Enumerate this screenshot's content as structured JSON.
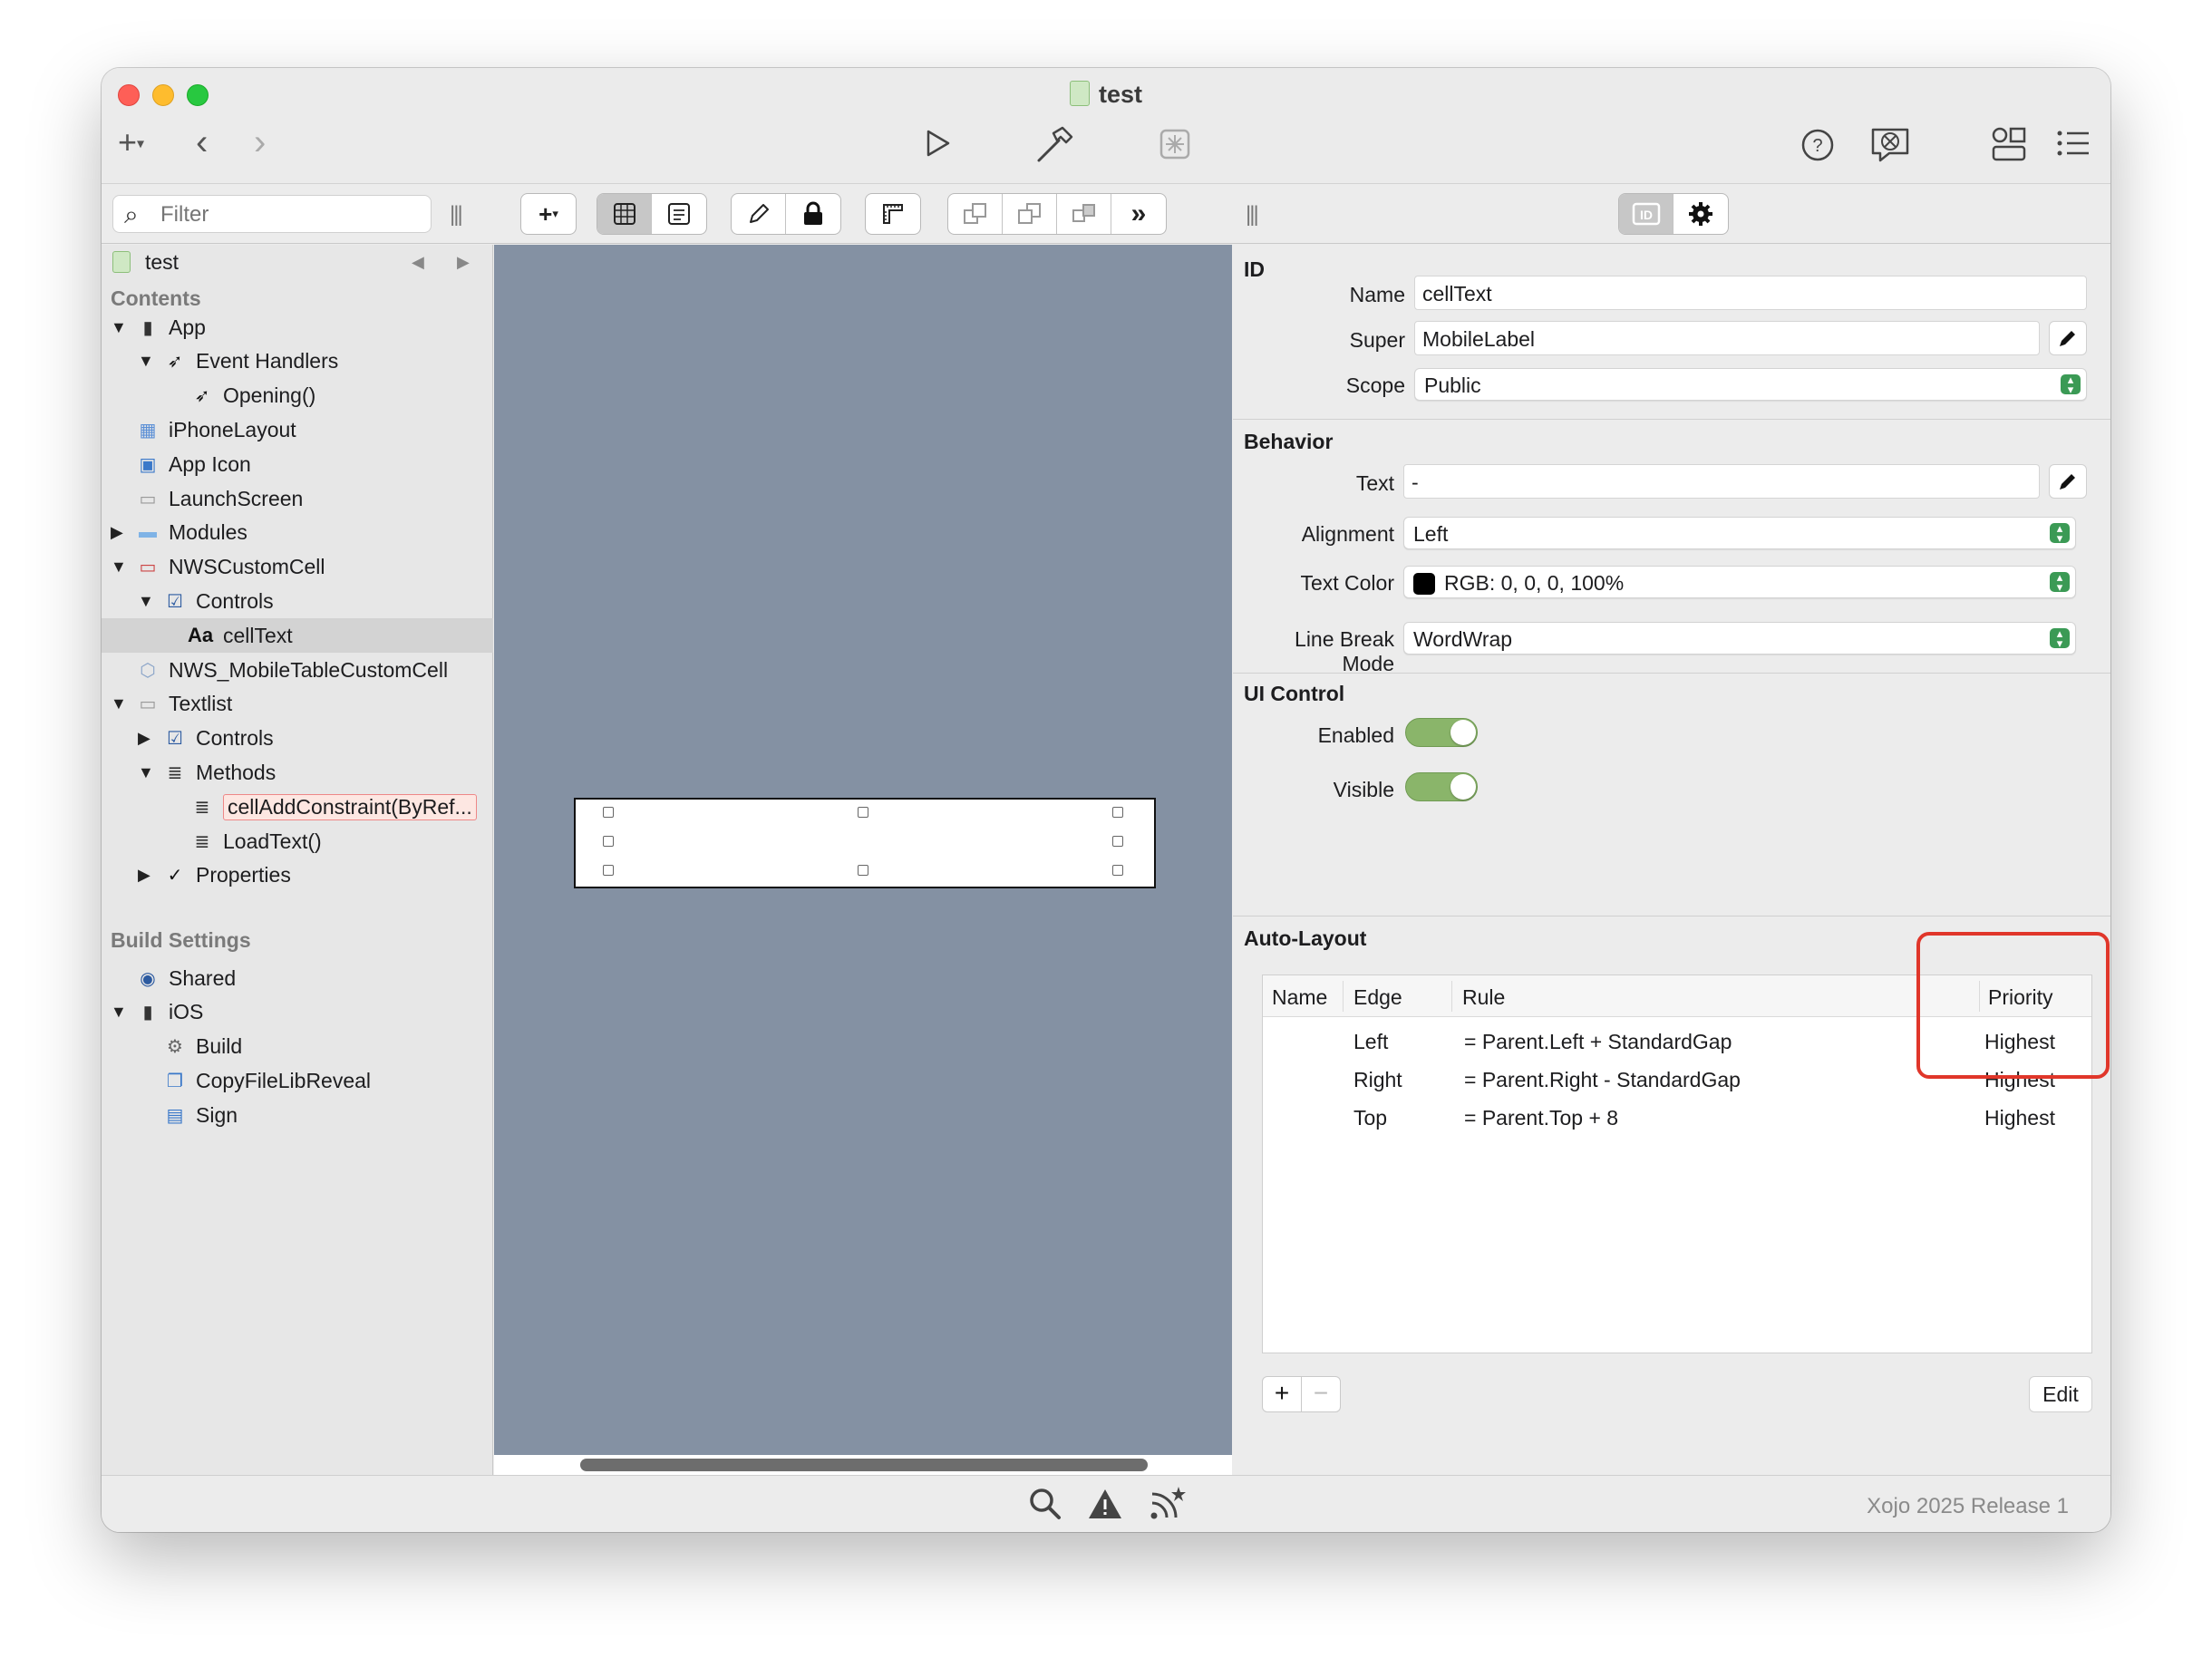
{
  "window": {
    "title": "test"
  },
  "toolbar": {
    "add_icon": "plus-icon",
    "back_icon": "chevron-left-icon",
    "forward_icon": "chevron-right-icon",
    "run_icon": "play-icon",
    "build_icon": "hammer-icon",
    "debug_icon": "bug-icon",
    "help_icon": "help-icon",
    "feedback_icon": "feedback-icon",
    "library_icon": "library-icon",
    "list_icon": "list-icon"
  },
  "navigator": {
    "filter_placeholder": "Filter",
    "project_name": "test",
    "contents_header": "Contents",
    "items": [
      {
        "label": "App",
        "depth": 0,
        "expanded": true
      },
      {
        "label": "Event Handlers",
        "depth": 1,
        "expanded": true
      },
      {
        "label": "Opening()",
        "depth": 2
      },
      {
        "label": "iPhoneLayout",
        "depth": 0
      },
      {
        "label": "App Icon",
        "depth": 0
      },
      {
        "label": "LaunchScreen",
        "depth": 0
      },
      {
        "label": "Modules",
        "depth": 0,
        "expanded": false
      },
      {
        "label": "NWSCustomCell",
        "depth": 0,
        "expanded": true
      },
      {
        "label": "Controls",
        "depth": 1,
        "expanded": true
      },
      {
        "label": "cellText",
        "depth": 2,
        "selected": true
      },
      {
        "label": "NWS_MobileTableCustomCell",
        "depth": 0
      },
      {
        "label": "Textlist",
        "depth": 0,
        "expanded": true
      },
      {
        "label": "Controls",
        "depth": 1,
        "expanded": false
      },
      {
        "label": "Methods",
        "depth": 1,
        "expanded": true
      },
      {
        "label": "cellAddConstraint(ByRef...",
        "depth": 2,
        "highlight": true
      },
      {
        "label": "LoadText()",
        "depth": 2
      },
      {
        "label": "Properties",
        "depth": 1,
        "expanded": false
      }
    ],
    "build_header": "Build Settings",
    "build_items": [
      {
        "label": "Shared",
        "depth": 0
      },
      {
        "label": "iOS",
        "depth": 0,
        "expanded": true
      },
      {
        "label": "Build",
        "depth": 1
      },
      {
        "label": "CopyFileLibReveal",
        "depth": 1
      },
      {
        "label": "Sign",
        "depth": 1
      }
    ]
  },
  "inspector": {
    "id_section": "ID",
    "name_label": "Name",
    "name_value": "cellText",
    "super_label": "Super",
    "super_value": "MobileLabel",
    "scope_label": "Scope",
    "scope_value": "Public",
    "behavior_section": "Behavior",
    "text_label": "Text",
    "text_value": "-",
    "alignment_label": "Alignment",
    "alignment_value": "Left",
    "textcolor_label": "Text Color",
    "textcolor_value": "RGB: 0, 0, 0, 100%",
    "linebreak_label": "Line Break Mode",
    "linebreak_value": "WordWrap",
    "uicontrol_section": "UI Control",
    "enabled_label": "Enabled",
    "enabled": true,
    "visible_label": "Visible",
    "visible": true,
    "autolayout_section": "Auto-Layout",
    "columns": [
      "Name",
      "Edge",
      "Rule",
      "Priority"
    ],
    "constraints": [
      {
        "name": "",
        "edge": "Left",
        "rule": "= Parent.Left + StandardGap",
        "priority": "Highest"
      },
      {
        "name": "",
        "edge": "Right",
        "rule": "= Parent.Right - StandardGap",
        "priority": "Highest"
      },
      {
        "name": "",
        "edge": "Top",
        "rule": "= Parent.Top + 8",
        "priority": "Highest"
      }
    ],
    "edit_label": "Edit"
  },
  "status": {
    "version": "Xojo 2025 Release 1"
  },
  "colors": {
    "canvas": "#8491a3",
    "toggle_on": "#8ab56a",
    "highlight": "#e0362a"
  }
}
